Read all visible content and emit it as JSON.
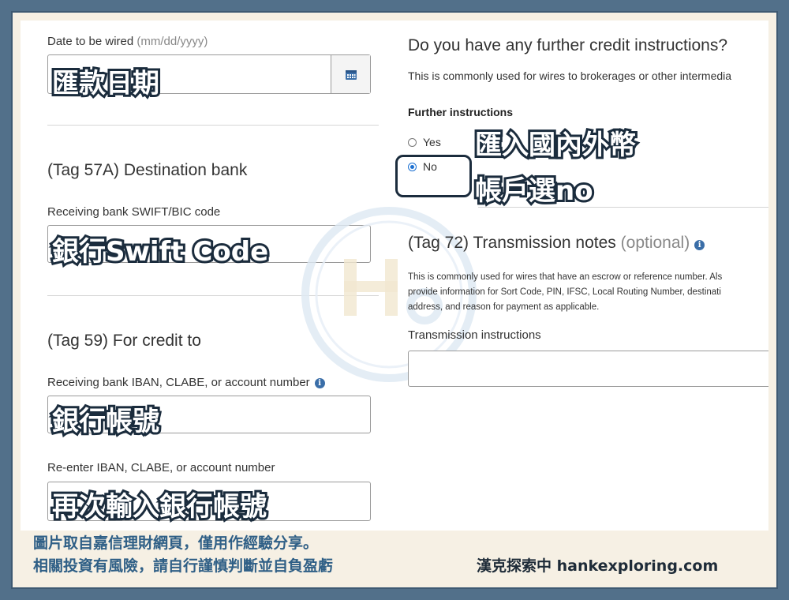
{
  "left": {
    "date_label": "Date to be wired",
    "date_format_hint": "(mm/dd/yyyy)",
    "date_value": "",
    "tag57_title": "(Tag 57A)  Destination bank",
    "swift_label": "Receiving bank SWIFT/BIC code",
    "swift_value": "",
    "tag59_title": "(Tag 59)  For credit to",
    "iban_label": "Receiving bank IBAN, CLABE, or account number",
    "iban_value": "",
    "iban_reenter_label": "Re-enter IBAN, CLABE, or account number",
    "iban_reenter_value": ""
  },
  "right": {
    "question_title": "Do you have any further credit instructions?",
    "question_desc": "This is commonly used for wires to brokerages or other intermedia",
    "further_label": "Further instructions",
    "options": [
      {
        "label": "Yes",
        "selected": false
      },
      {
        "label": "No",
        "selected": true
      }
    ],
    "tag72_title": "(Tag 72) Transmission notes",
    "tag72_optional": "(optional)",
    "tag72_desc": [
      "This is commonly used for wires that have an escrow or reference number. Als",
      "provide information for Sort Code, PIN, IFSC, Local Routing Number, destinati",
      "address, and reason for payment as applicable."
    ],
    "transmission_label": "Transmission instructions",
    "transmission_value": ""
  },
  "annotations": {
    "date": "匯款日期",
    "swift": "銀行Swift  Code",
    "account": "銀行帳號",
    "reenter": "再次輸入銀行帳號",
    "no_line1": "匯入國內外幣",
    "no_line2": "帳戶選no"
  },
  "footer": {
    "disclaimer_line1": "圖片取自嘉信理財網頁，僅用作經驗分享。",
    "disclaimer_line2": "相關投資有風險，請自行謹慎判斷並自負盈虧",
    "brand": "漢克探索中 hankexploring.com"
  },
  "colors": {
    "border": "#52708a",
    "cream": "#f6f0e4",
    "footer_text": "#2f5f86",
    "radio_accent": "#1a6fd1",
    "info_icon": "#3a6ea8"
  },
  "icons": {
    "calendar": "calendar-icon",
    "info": "info-icon"
  }
}
